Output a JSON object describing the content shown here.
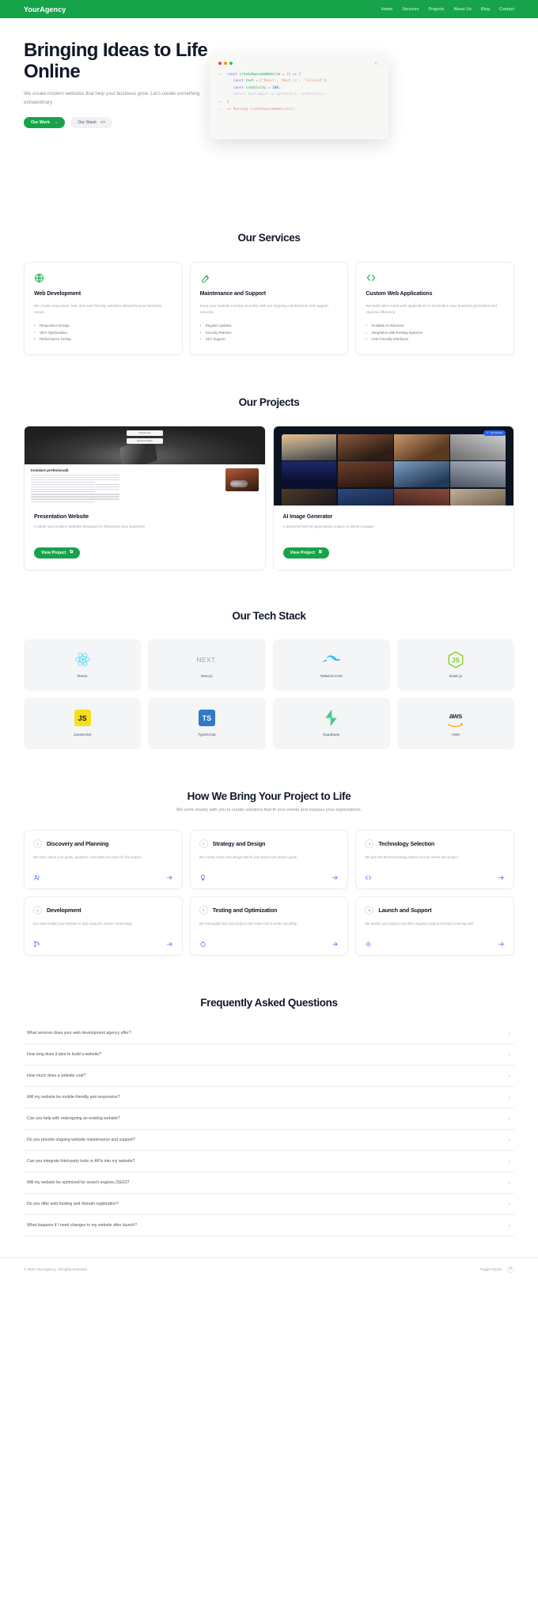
{
  "header": {
    "brand": "YourAgency",
    "nav": [
      {
        "label": "Home"
      },
      {
        "label": "Services"
      },
      {
        "label": "Projects"
      },
      {
        "label": "About Us"
      },
      {
        "label": "Blog"
      },
      {
        "label": "Contact"
      }
    ]
  },
  "hero": {
    "title": "Bringing Ideas to Life Online",
    "subtitle": "We create modern websites that help your business grow. Let's create something extraordinary.",
    "primary_button": "Our Work",
    "primary_icon": "arrow-right-icon",
    "secondary_button": "Our Stack",
    "secondary_icon": "code-brackets-icon",
    "code": {
      "prompt_icon": ">_",
      "lines": [
        {
          "gutter": "<>",
          "text": "const createAwesomeWebsite = () => {"
        },
        {
          "gutter": "",
          "text": "const tech = ['React', 'Next.js', 'Tailwind'];"
        },
        {
          "gutter": "",
          "text": "const creativity = 100;"
        },
        {
          "gutter": "",
          "text": "return tech.map(t => optimize(t, creativity));"
        },
        {
          "gutter": "<>",
          "text": "}"
        },
        {
          "gutter": ">_",
          "text": ">> Running createAwesomeWebsite()..."
        }
      ]
    }
  },
  "services": {
    "title": "Our Services",
    "cards": [
      {
        "icon": "globe-icon",
        "name": "Web Development",
        "description": "We create responsive, fast, and user-friendly websites tailored to your business needs.",
        "features": [
          "Responsive Design",
          "SEO Optimization",
          "Performance Tuning"
        ]
      },
      {
        "icon": "wrench-icon",
        "name": "Maintenance and Support",
        "description": "Keep your website running smoothly with our ongoing maintenance and support services.",
        "features": [
          "Regular Updates",
          "Security Patches",
          "24/7 Support"
        ]
      },
      {
        "icon": "code-brackets-icon",
        "name": "Custom Web Applications",
        "description": "We build tailor-made web applications to streamline your business processes and improve efficiency.",
        "features": [
          "Scalable Architecture",
          "Integration with Existing Systems",
          "User-Friendly Interfaces"
        ]
      }
    ]
  },
  "projects": {
    "title": "Our Projects",
    "cards": [
      {
        "name": "Presentation Website",
        "description": "A sleek and modern website designed to showcase your business.",
        "button": "View Project",
        "button_icon": "external-link-icon",
        "thumb_pill_a": "Vizionare site",
        "thumb_pill_b": "Descarcă catalog",
        "thumb_heading": "Instalare profesională"
      },
      {
        "name": "AI Image Generator",
        "description": "A powerful tool for generating unique AI-driven images.",
        "button": "View Project",
        "button_icon": "external-link-icon",
        "badge": "Get Started"
      }
    ]
  },
  "tech_stack": {
    "title": "Our Tech Stack",
    "items": [
      {
        "name": "React",
        "icon": "react-icon"
      },
      {
        "name": "Next.js",
        "icon": "nextjs-icon"
      },
      {
        "name": "Tailwind CSS",
        "icon": "tailwind-icon"
      },
      {
        "name": "Node.js",
        "icon": "nodejs-icon"
      },
      {
        "name": "JavaScript",
        "icon": "javascript-icon"
      },
      {
        "name": "TypeScript",
        "icon": "typescript-icon"
      },
      {
        "name": "Supabase",
        "icon": "supabase-icon"
      },
      {
        "name": "AWS",
        "icon": "aws-icon"
      }
    ]
  },
  "process": {
    "title": "How We Bring Your Project to Life",
    "subtitle": "We work closely with you to create solutions that fit your needs and surpass your expectations.",
    "steps": [
      {
        "number": "1",
        "title": "Discovery and Planning",
        "description": "We learn about your goals, audience, and what you need for the project.",
        "icon": "users-icon",
        "arrow": "arrow-right-icon"
      },
      {
        "number": "2",
        "title": "Strategy and Design",
        "description": "We create a plan and design that fit your brand and project goals.",
        "icon": "lightbulb-icon",
        "arrow": "arrow-right-icon"
      },
      {
        "number": "3",
        "title": "Technology Selection",
        "description": "We pick the best technology based on your needs and project.",
        "icon": "code-brackets-icon",
        "arrow": "arrow-right-icon"
      },
      {
        "number": "4",
        "title": "Development",
        "description": "Our team builds your website or app using the chosen technology.",
        "icon": "branch-icon",
        "arrow": "arrow-right-icon"
      },
      {
        "number": "5",
        "title": "Testing and Optimization",
        "description": "We thoroughly test your project and make sure it works smoothly.",
        "icon": "target-icon",
        "arrow": "arrow-right-icon"
      },
      {
        "number": "6",
        "title": "Launch and Support",
        "description": "We launch your project and offer ongoing support to keep it running well.",
        "icon": "gear-icon",
        "arrow": "arrow-right-icon"
      }
    ]
  },
  "faq": {
    "title": "Frequently Asked Questions",
    "items": [
      {
        "question": "What services does your web development agency offer?"
      },
      {
        "question": "How long does it take to build a website?"
      },
      {
        "question": "How much does a website cost?"
      },
      {
        "question": "Will my website be mobile-friendly and responsive?"
      },
      {
        "question": "Can you help with redesigning an existing website?"
      },
      {
        "question": "Do you provide ongoing website maintenance and support?"
      },
      {
        "question": "Can you integrate third-party tools or APIs into my website?"
      },
      {
        "question": "Will my website be optimized for search engines (SEO)?"
      },
      {
        "question": "Do you offer web hosting and domain registration?"
      },
      {
        "question": "What happens if I need changes to my website after launch?"
      }
    ],
    "chevron": "chevron-down-icon"
  },
  "footer": {
    "copyright": "© 2023 YourAgency. All rights reserved.",
    "theme_label": "Toggle theme",
    "theme_icon": "sun-icon"
  },
  "colors": {
    "brand_green": "#16a34a",
    "accent_blue": "#4f6ef7",
    "muted_text": "#9ca3af"
  }
}
